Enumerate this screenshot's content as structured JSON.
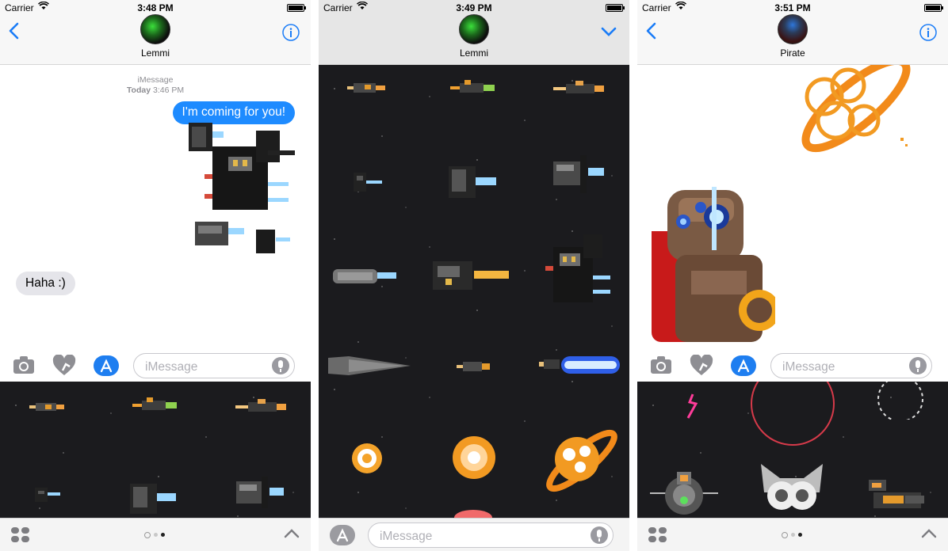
{
  "screens": [
    {
      "status": {
        "carrier": "Carrier",
        "time": "3:48 PM"
      },
      "contact": {
        "name": "Lemmi"
      },
      "thread": {
        "service": "iMessage",
        "day": "Today",
        "time": "3:46 PM"
      },
      "messages": {
        "outgoing": "I'm coming for you!",
        "incoming": "Haha :)"
      },
      "compose": {
        "placeholder": "iMessage"
      }
    },
    {
      "status": {
        "carrier": "Carrier",
        "time": "3:49 PM"
      },
      "contact": {
        "name": "Lemmi"
      },
      "compose": {
        "placeholder": "iMessage"
      }
    },
    {
      "status": {
        "carrier": "Carrier",
        "time": "3:51 PM"
      },
      "contact": {
        "name": "Pirate"
      },
      "compose": {
        "placeholder": "iMessage"
      }
    }
  ],
  "colors": {
    "accent": "#1a7cf7",
    "bubble_out": "#1e8bff",
    "bubble_in": "#e5e5ea",
    "space": "#1b1b1e"
  },
  "icons": [
    "back-chevron-icon",
    "info-icon",
    "chevron-down-icon",
    "camera-icon",
    "digital-touch-icon",
    "app-store-icon",
    "microphone-icon",
    "app-drawer-icon",
    "chevron-up-icon",
    "recent-clock-icon"
  ]
}
